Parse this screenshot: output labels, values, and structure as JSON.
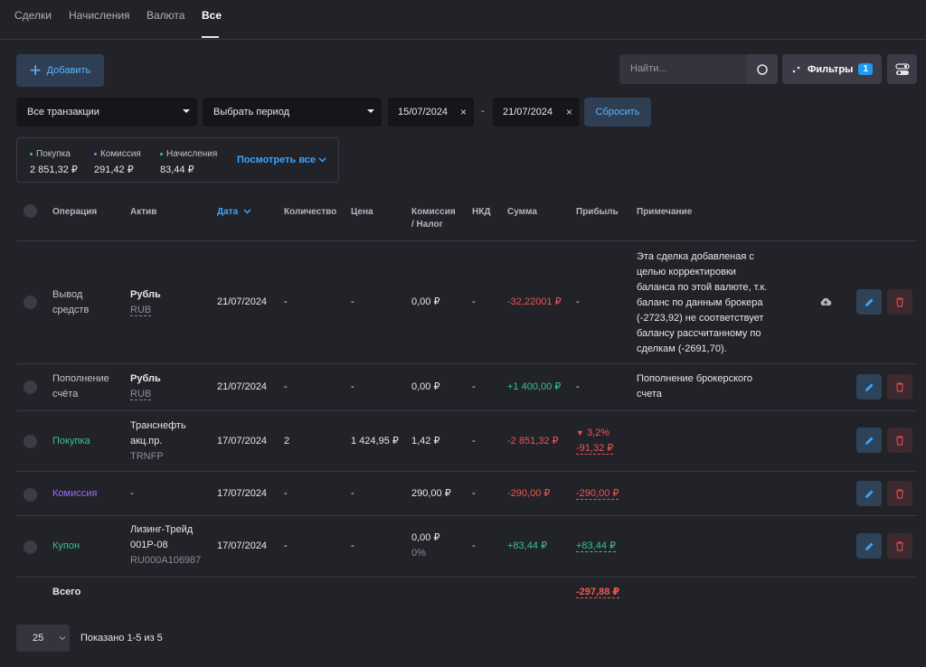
{
  "tabs": [
    "Сделки",
    "Начисления",
    "Валюта",
    "Все"
  ],
  "toolbar": {
    "add_label": "Добавить",
    "search_placeholder": "Найти...",
    "filters_label": "Фильтры",
    "filters_count": "1"
  },
  "filters": {
    "transactions": "Все транзакции",
    "period": "Выбрать период",
    "date_from": "15/07/2024",
    "date_to": "21/07/2024",
    "reset_label": "Сбросить"
  },
  "summary": {
    "items": [
      {
        "label": "Покупка",
        "value": "2 851,32 ₽",
        "color": "#35c58a"
      },
      {
        "label": "Комиссия",
        "value": "291,42 ₽",
        "color": "#9b6bff"
      },
      {
        "label": "Начисления",
        "value": "83,44 ₽",
        "color": "#35c58a"
      }
    ],
    "see_all": "Посмотреть все"
  },
  "table": {
    "headers": {
      "operation": "Операция",
      "asset": "Актив",
      "date": "Дата",
      "quantity": "Количество",
      "price": "Цена",
      "commission_1": "Комиссия",
      "commission_2": "/ Налог",
      "nkd": "НКД",
      "sum": "Сумма",
      "profit": "Прибыль",
      "note": "Примечание"
    },
    "rows": [
      {
        "op1": "Вывод",
        "op2": "средств",
        "asset1": "Рубль",
        "asset_code": "RUB",
        "date": "21/07/2024",
        "qty": "-",
        "price": "-",
        "commission": "0,00 ₽",
        "nkd": "-",
        "sum": "-32,22001 ₽",
        "profit": "-",
        "note": [
          "Эта сделка добавленая с",
          "целью корректировки",
          "баланса по этой валюте, т.к.",
          "баланс по данным брокера",
          "(-2723,92) не соответствует",
          "балансу рассчитанному по",
          "сделкам (-2691,70)."
        ]
      },
      {
        "op1": "Пополнение",
        "op2": "счёта",
        "asset1": "Рубль",
        "asset_code": "RUB",
        "date": "21/07/2024",
        "qty": "-",
        "price": "-",
        "commission": "0,00 ₽",
        "nkd": "-",
        "sum": "+1 400,00 ₽",
        "profit": "-",
        "note": [
          "Пополнение брокерского",
          "счета"
        ]
      },
      {
        "op1": "Покупка",
        "asset1": "Транснефть",
        "asset2": "акц.пр.",
        "asset_code": "TRNFP",
        "date": "17/07/2024",
        "qty": "2",
        "price": "1 424,95 ₽",
        "commission": "1,42 ₽",
        "nkd": "-",
        "sum": "-2 851,32 ₽",
        "profit_pct": "3,2%",
        "profit": "-91,32 ₽"
      },
      {
        "op1": "Комиссия",
        "asset1": "-",
        "date": "17/07/2024",
        "qty": "-",
        "price": "-",
        "commission": "290,00 ₽",
        "nkd": "-",
        "sum": "-290,00 ₽",
        "profit": "-290,00 ₽"
      },
      {
        "op1": "Купон",
        "asset1": "Лизинг-Трейд",
        "asset2": "001P-08",
        "asset_code": "RU000A106987",
        "date": "17/07/2024",
        "qty": "-",
        "price": "-",
        "commission": "0,00 ₽",
        "commission_sub": "0%",
        "nkd": "-",
        "sum": "+83,44 ₽",
        "profit": "+83,44 ₽"
      }
    ],
    "total_label": "Всего",
    "total_profit": "-297,88 ₽"
  },
  "pager": {
    "page_size": "25",
    "shown": "Показано 1-5 из 5"
  }
}
